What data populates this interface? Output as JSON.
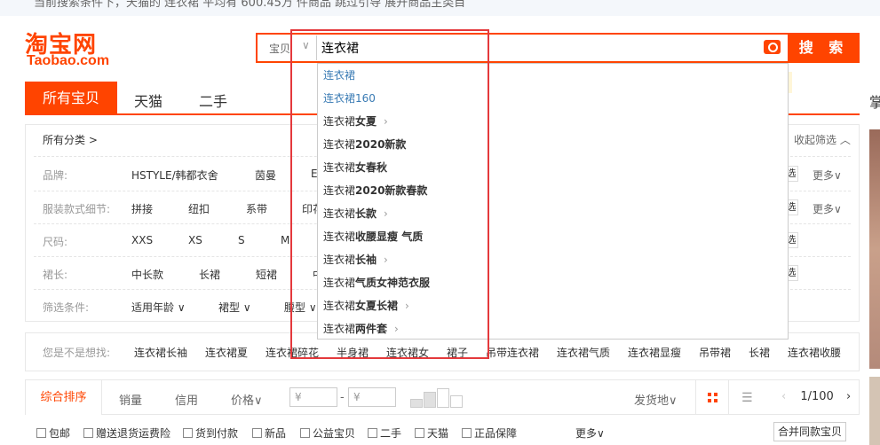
{
  "top_strip_text": "当前搜索条件下，天猫的 连衣裙 平均有 600.45万 件商品    跳过引导    展开商品主类目",
  "logo": {
    "cn": "淘宝网",
    "en": "Taobao.com"
  },
  "search": {
    "scope": "宝贝",
    "query": "连衣裙",
    "button": "搜 索"
  },
  "suggestions": [
    {
      "pre": "连衣裙",
      "bold": "",
      "chevron": false,
      "blue": true
    },
    {
      "pre": "连衣裙160",
      "bold": "",
      "chevron": false,
      "blue": true
    },
    {
      "pre": "连衣裙",
      "bold": "女夏",
      "chevron": true,
      "blue": false
    },
    {
      "pre": "连衣裙",
      "bold": "2020新款",
      "chevron": false,
      "blue": false
    },
    {
      "pre": "连衣裙",
      "bold": "女春秋",
      "chevron": false,
      "blue": false
    },
    {
      "pre": "连衣裙",
      "bold": "2020新款春款",
      "chevron": false,
      "blue": false
    },
    {
      "pre": "连衣裙",
      "bold": "长款",
      "chevron": true,
      "blue": false
    },
    {
      "pre": "连衣裙",
      "bold": "收腰显瘦 气质",
      "chevron": false,
      "blue": false
    },
    {
      "pre": "连衣裙",
      "bold": "长袖",
      "chevron": true,
      "blue": false
    },
    {
      "pre": "连衣裙",
      "bold": "气质女神范衣服",
      "chevron": false,
      "blue": false
    },
    {
      "pre": "连衣裙",
      "bold": "女夏长裙",
      "chevron": true,
      "blue": false
    },
    {
      "pre": "连衣裙",
      "bold": "两件套",
      "chevron": true,
      "blue": false
    }
  ],
  "tabs": {
    "active": "所有宝贝",
    "tmall": "天猫",
    "used": "二手"
  },
  "filters": {
    "all_categories": "所有分类 >",
    "collapse": "收起筛选 ︿",
    "rows": [
      {
        "label": "品牌:",
        "values": [
          "HSTYLE/韩都衣舍",
          "茵曼",
          "E"
        ],
        "side": "选",
        "more": "更多∨"
      },
      {
        "label": "服装款式细节:",
        "values": [
          "拼接",
          "纽扣",
          "系带",
          "印花"
        ],
        "side": "选",
        "more": "更多∨"
      },
      {
        "label": "尺码:",
        "values": [
          "XXS",
          "XS",
          "S",
          "M"
        ],
        "side": "选",
        "more": ""
      },
      {
        "label": "裙长:",
        "values": [
          "中长款",
          "长裙",
          "短裙",
          "中"
        ],
        "side": "选",
        "more": ""
      },
      {
        "label": "筛选条件:",
        "values": [
          "适用年龄 ∨",
          "裙型 ∨",
          "腰型 ∨"
        ],
        "side": "",
        "more": ""
      }
    ]
  },
  "related": {
    "label": "您是不是想找:",
    "items": [
      "连衣裙长袖",
      "连衣裙夏",
      "连衣裙碎花",
      "半身裙",
      "连衣裙女",
      "裙子",
      "吊带连衣裙",
      "连衣裙气质",
      "连衣裙显瘦",
      "吊带裙",
      "长裙",
      "连衣裙收腰"
    ]
  },
  "sort": {
    "active": "综合排序",
    "sales": "销量",
    "credit": "信用",
    "price": "价格∨",
    "price_min": "¥",
    "price_dash": "-",
    "price_max": "¥",
    "location": "发货地∨",
    "page_current": "1",
    "page_total": "/100"
  },
  "checks": [
    "包邮",
    "赠送退货运费险",
    "货到付款",
    "新品",
    "公益宝贝",
    "二手",
    "天猫",
    "正品保障"
  ],
  "more_filters": "更多∨",
  "merge_button": "合并同款宝贝",
  "right_edge_text": "掌",
  "colors": {
    "brand": "#ff4400",
    "highlight_box": "#e4393c",
    "link_blue": "#3a7bb4"
  }
}
